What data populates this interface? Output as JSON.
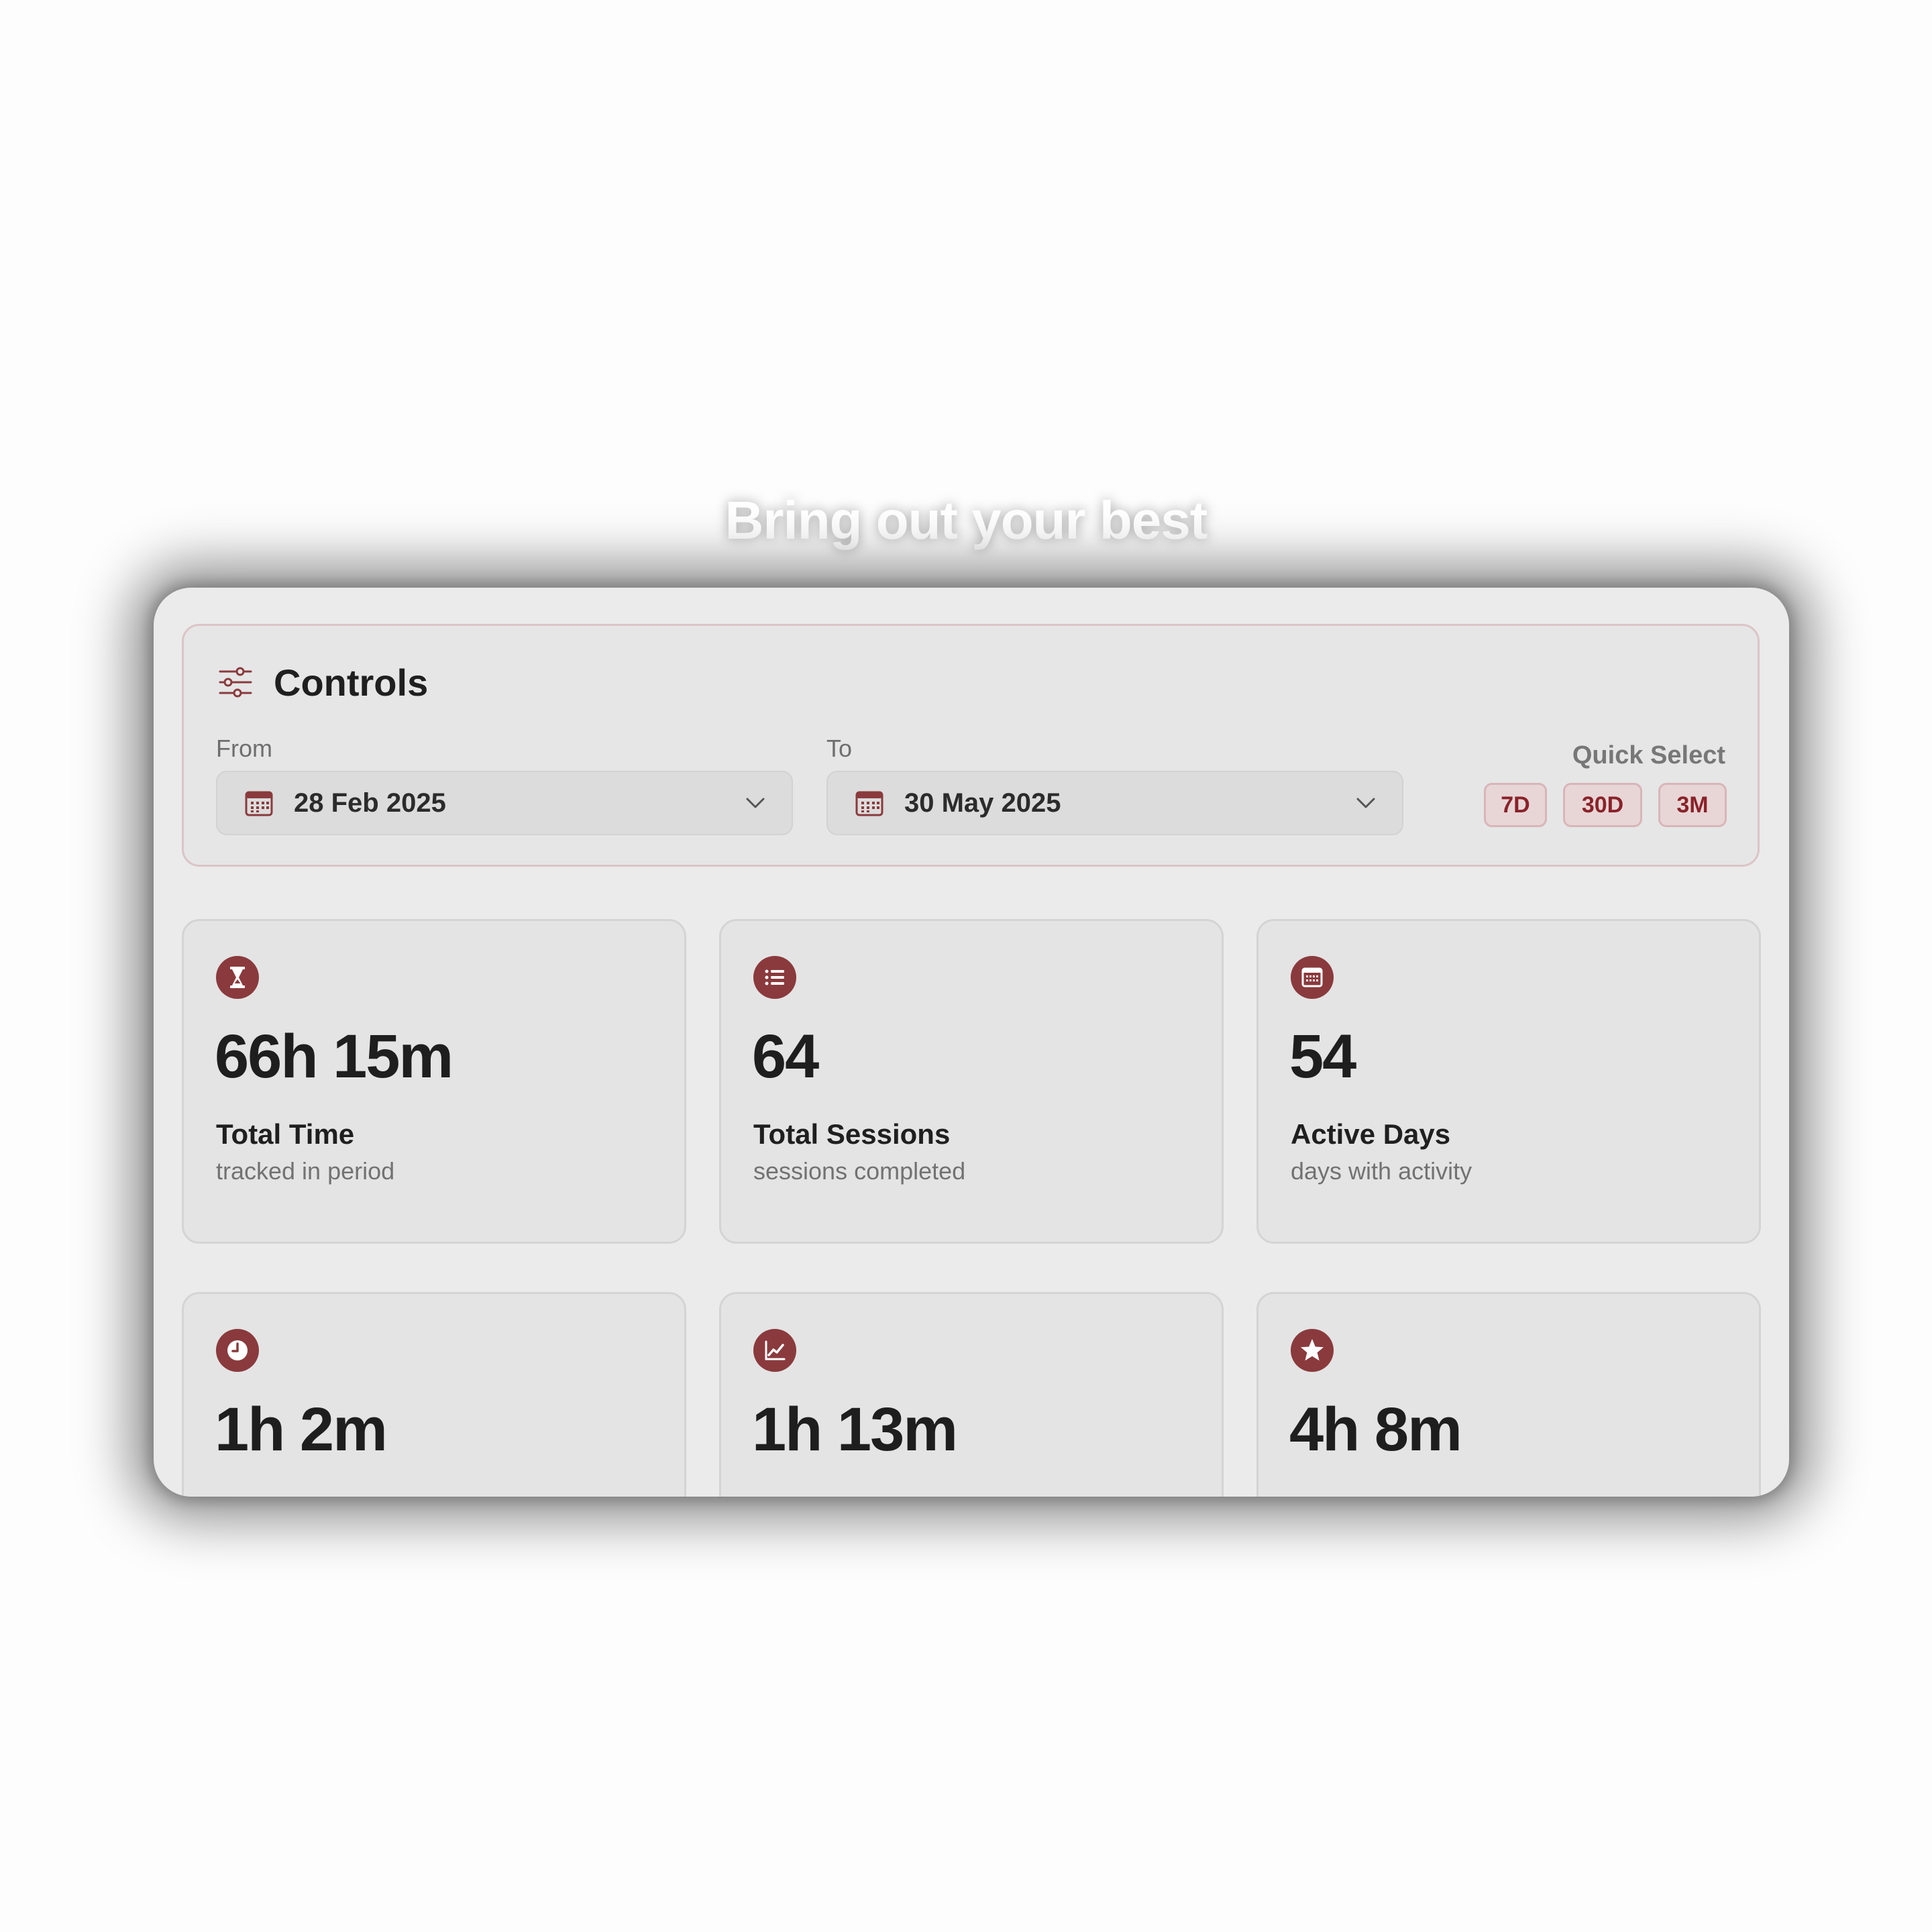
{
  "tagline": "Bring out your best",
  "controls": {
    "title": "Controls",
    "icon": "sliders-icon",
    "from_label": "From",
    "from_value": "28 Feb 2025",
    "to_label": "To",
    "to_value": "30 May 2025",
    "quick_select_label": "Quick Select",
    "quick_options": [
      "7D",
      "30D",
      "3M"
    ]
  },
  "stats": [
    {
      "icon": "hourglass-icon",
      "value": "66h 15m",
      "label": "Total Time",
      "sub": "tracked in period"
    },
    {
      "icon": "list-icon",
      "value": "64",
      "label": "Total Sessions",
      "sub": "sessions completed"
    },
    {
      "icon": "calendar-icon",
      "value": "54",
      "label": "Active Days",
      "sub": "days with activity"
    },
    {
      "icon": "clock-icon",
      "value": "1h 2m",
      "label": "",
      "sub": ""
    },
    {
      "icon": "trend-chart-icon",
      "value": "1h 13m",
      "label": "",
      "sub": ""
    },
    {
      "icon": "star-icon",
      "value": "4h 8m",
      "label": "",
      "sub": ""
    }
  ],
  "colors": {
    "accent": "#8a3a3d",
    "window_bg": "#ebebeb",
    "card_bg": "#e4e4e4"
  }
}
